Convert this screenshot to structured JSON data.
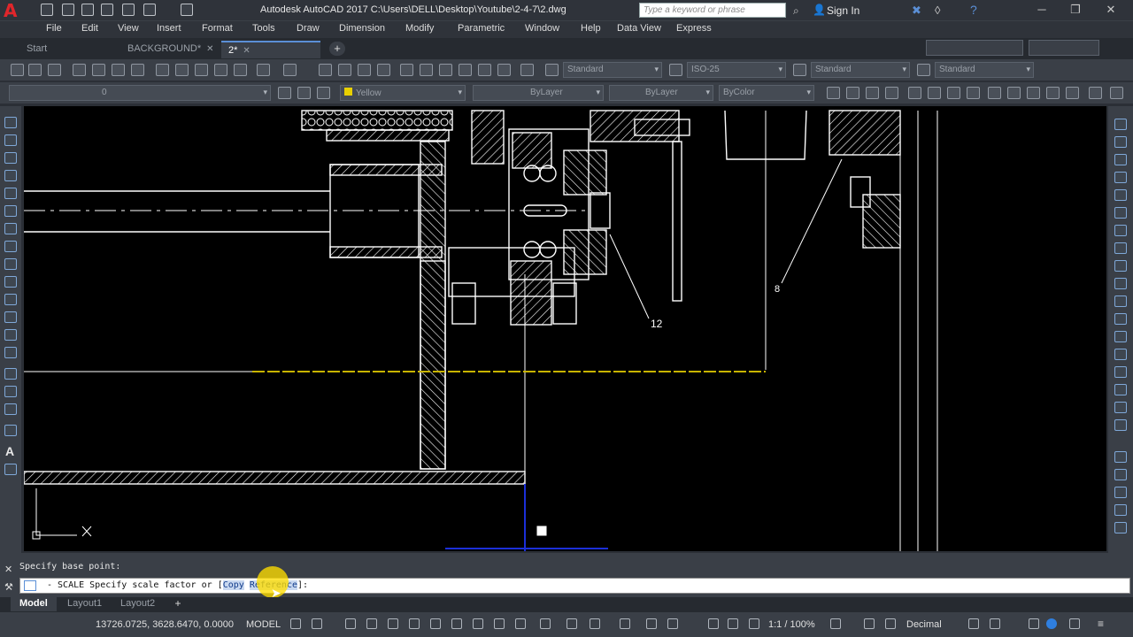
{
  "app": {
    "logo": "A",
    "title": "Autodesk AutoCAD 2017    C:\\Users\\DELL\\Desktop\\Youtube\\2-4-7\\2.dwg",
    "search_placeholder": "Type a keyword or phrase",
    "sign_in": "Sign In"
  },
  "menu": [
    "File",
    "Edit",
    "View",
    "Insert",
    "Format",
    "Tools",
    "Draw",
    "Dimension",
    "Modify",
    "Parametric",
    "Window",
    "Help",
    "Data View",
    "Express"
  ],
  "tabs": [
    {
      "label": "Start"
    },
    {
      "label": "BACKGROUND*"
    },
    {
      "label": "2*"
    }
  ],
  "toolbar1": {
    "text_style": "Standard",
    "dim_style": "ISO-25",
    "table_style": "Standard",
    "mleader_style": "Standard"
  },
  "toolbar2": {
    "layer": "0",
    "color": "Yellow",
    "linetype": "ByLayer",
    "lineweight": "ByLayer",
    "plotstyle": "ByColor"
  },
  "drawing": {
    "balloon_12": "12",
    "balloon_8": "8"
  },
  "command": {
    "history": "Specify base point:",
    "prefix": "- SCALE Specify scale factor or [",
    "opt_copy": "Copy",
    "opt_reference": "Reference",
    "suffix": "]:"
  },
  "layout_tabs": [
    "Model",
    "Layout1",
    "Layout2"
  ],
  "status": {
    "coordinates": "13726.0725, 3628.6470, 0.0000",
    "space": "MODEL",
    "scale": "1:1 / 100%",
    "units": "Decimal"
  },
  "colors": {
    "canvas": "#000000",
    "geometry": "#ffffff",
    "selected_line": "#c8b400",
    "ucs": "#ffffff",
    "logo": "#e0262b"
  }
}
